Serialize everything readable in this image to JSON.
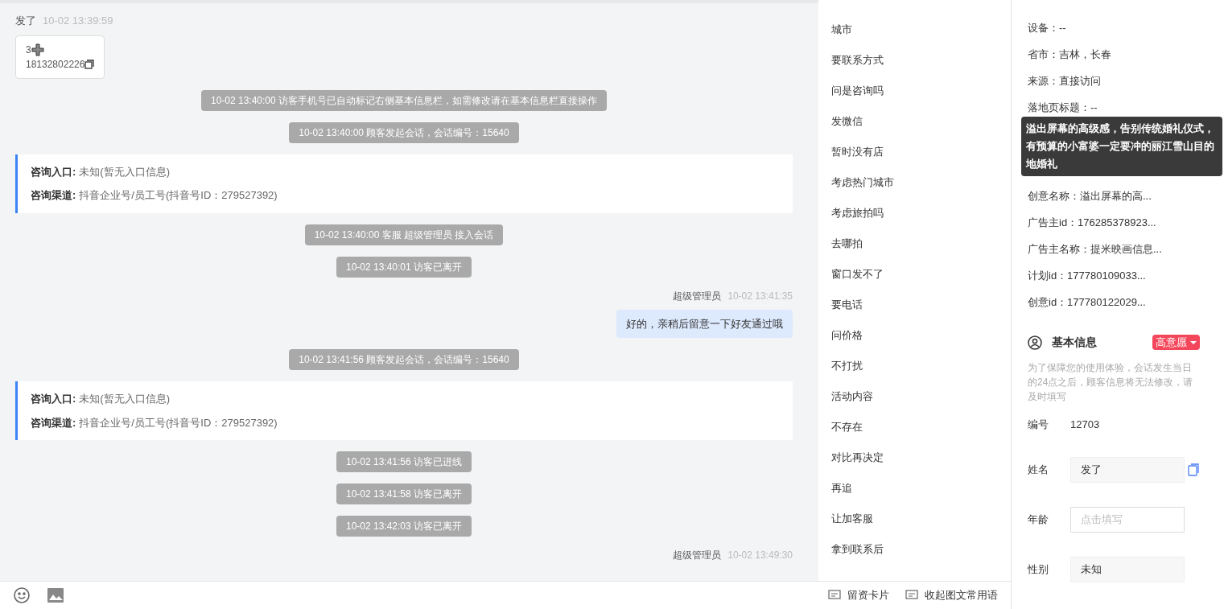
{
  "chat": {
    "messages": [
      {
        "kind": "card",
        "sender": "发了",
        "time": "10-02 13:39:59",
        "line1": "3",
        "line2": "18132802226"
      },
      {
        "kind": "system",
        "text": "10-02 13:40:00 访客手机号已自动标记右侧基本信息栏，如需修改请在基本信息栏直接操作"
      },
      {
        "kind": "system",
        "text": "10-02 13:40:00 顾客发起会话，会话编号：15640"
      },
      {
        "kind": "info",
        "rows": [
          {
            "label": "咨询入口:",
            "value": "未知(暂无入口信息)"
          },
          {
            "label": "咨询渠道:",
            "value": "抖音企业号/员工号(抖音号ID：279527392)"
          }
        ]
      },
      {
        "kind": "system",
        "text": "10-02 13:40:00 客服 超级管理员 接入会话"
      },
      {
        "kind": "system",
        "text": "10-02 13:40:01 访客已离开"
      },
      {
        "kind": "agent",
        "sender": "超级管理员",
        "time": "10-02 13:41:35",
        "text": "好的，亲稍后留意一下好友通过哦"
      },
      {
        "kind": "system",
        "text": "10-02 13:41:56 顾客发起会话，会话编号：15640"
      },
      {
        "kind": "info",
        "rows": [
          {
            "label": "咨询入口:",
            "value": "未知(暂无入口信息)"
          },
          {
            "label": "咨询渠道:",
            "value": "抖音企业号/员工号(抖音号ID：279527392)"
          }
        ]
      },
      {
        "kind": "system",
        "text": "10-02 13:41:56 访客已进线"
      },
      {
        "kind": "system",
        "text": "10-02 13:41:58 访客已离开"
      },
      {
        "kind": "system",
        "text": "10-02 13:42:03 访客已离开"
      },
      {
        "kind": "agent_meta",
        "sender": "超级管理员",
        "time": "10-02 13:49:30"
      }
    ]
  },
  "toolbar": {
    "right": [
      "留资卡片",
      "收起图文常用语"
    ]
  },
  "phrases": [
    "城市",
    "要联系方式",
    "问是咨询吗",
    "发微信",
    "暂时没有店",
    "考虑热门城市",
    "考虑旅拍吗",
    "去哪拍",
    "窗口发不了",
    "要电话",
    "问价格",
    "不打扰",
    "活动内容",
    "不存在",
    "对比再决定",
    "再追",
    "让加客服",
    "拿到联系后"
  ],
  "source_info": {
    "rows": [
      "设备：--",
      "省市：吉林，长春",
      "来源：直接访问",
      "落地页标题：--"
    ],
    "tooltip": "溢出屏幕的高级感，告别传统婚礼仪式，有预算的小富婆一定要冲的丽江雪山目的地婚礼",
    "rows_after": [
      "创意名称：溢出屏幕的高...",
      "广告主id：176285378923...",
      "广告主名称：提米映画信息...",
      "计划id：177780109033...",
      "创意id：177780122029..."
    ]
  },
  "basic_info": {
    "title": "基本信息",
    "tag": "高意愿",
    "note": "为了保障您的使用体验，会话发生当日的24点之后，顾客信息将无法修改，请及时填写",
    "fields": [
      {
        "kind": "text",
        "label": "编号",
        "value": "12703"
      },
      {
        "kind": "filled",
        "label": "姓名",
        "value": "发了",
        "copy": true
      },
      {
        "kind": "input",
        "label": "年龄",
        "placeholder": "点击填写"
      },
      {
        "kind": "filled",
        "label": "性别",
        "value": "未知",
        "copy": false
      }
    ]
  }
}
